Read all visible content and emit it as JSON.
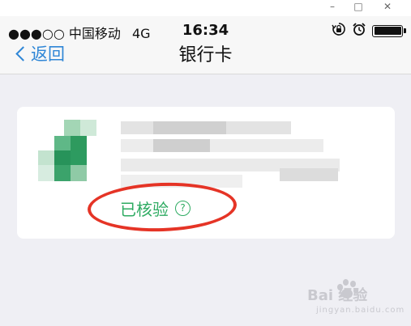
{
  "window": {
    "minimize": "–",
    "maximize": "□",
    "close": "✕"
  },
  "status_bar": {
    "carrier": "●●●○○ 中国移动",
    "network": "4G",
    "time": "16:34",
    "icons": [
      "rotation-lock-icon",
      "alarm-icon",
      "battery-icon"
    ]
  },
  "nav": {
    "back_label": "返回",
    "title": "银行卡"
  },
  "card": {
    "verified_label": "已核验",
    "help_glyph": "?",
    "accent_color": "#2eab62",
    "highlight_color": "#e53426"
  },
  "watermark": {
    "text": "Bai 经验",
    "sub": "jingyan.baidu.com"
  }
}
